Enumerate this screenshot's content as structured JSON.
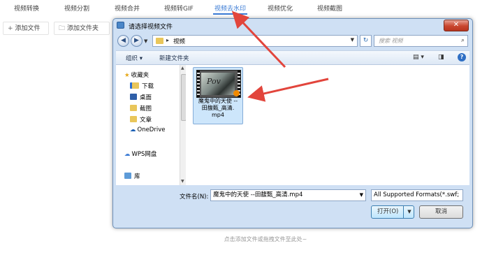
{
  "top_tabs": [
    {
      "label": "视频转换",
      "active": false
    },
    {
      "label": "视频分割",
      "active": false
    },
    {
      "label": "视频合并",
      "active": false
    },
    {
      "label": "视频转GIF",
      "active": false
    },
    {
      "label": "视频去水印",
      "active": true
    },
    {
      "label": "视频优化",
      "active": false
    },
    {
      "label": "视频截图",
      "active": false
    }
  ],
  "toolbar": {
    "add_file": "添加文件",
    "add_folder": "添加文件夹",
    "add_file_icon": "plus-icon",
    "add_folder_icon": "folder-icon"
  },
  "hint": "点击添加文件或拖拽文件至此处~",
  "dialog": {
    "title": "请选择视频文件",
    "close_glyph": "✕",
    "path": "视频",
    "search_placeholder": "搜索 视频",
    "organize": "组织 ▾",
    "new_folder": "新建文件夹",
    "nav": [
      {
        "label": "收藏夹",
        "icon": "star-icon"
      },
      {
        "label": "下载",
        "icon": "download-folder-icon"
      },
      {
        "label": "桌面",
        "icon": "desktop-icon"
      },
      {
        "label": "截图",
        "icon": "folder-icon"
      },
      {
        "label": "文章",
        "icon": "folder-icon"
      },
      {
        "label": "OneDrive",
        "icon": "cloud-icon"
      },
      {
        "label": "WPS网盘",
        "icon": "cloud-outline-icon"
      },
      {
        "label": "库",
        "icon": "library-icon"
      }
    ],
    "file": {
      "name_lines": [
        "魔鬼中的天使 --",
        "田馥甄_高清.",
        "mp4"
      ]
    },
    "filename_label": "文件名(N):",
    "filename_value": "魔鬼中的天使 --田馥甄_高清.mp4",
    "filter_value": "All Supported Formats(*.swf;",
    "open_label": "打开(O)",
    "cancel_label": "取消"
  },
  "colors": {
    "accent": "#3a7bd5",
    "annotation_arrow": "#e2453c"
  }
}
